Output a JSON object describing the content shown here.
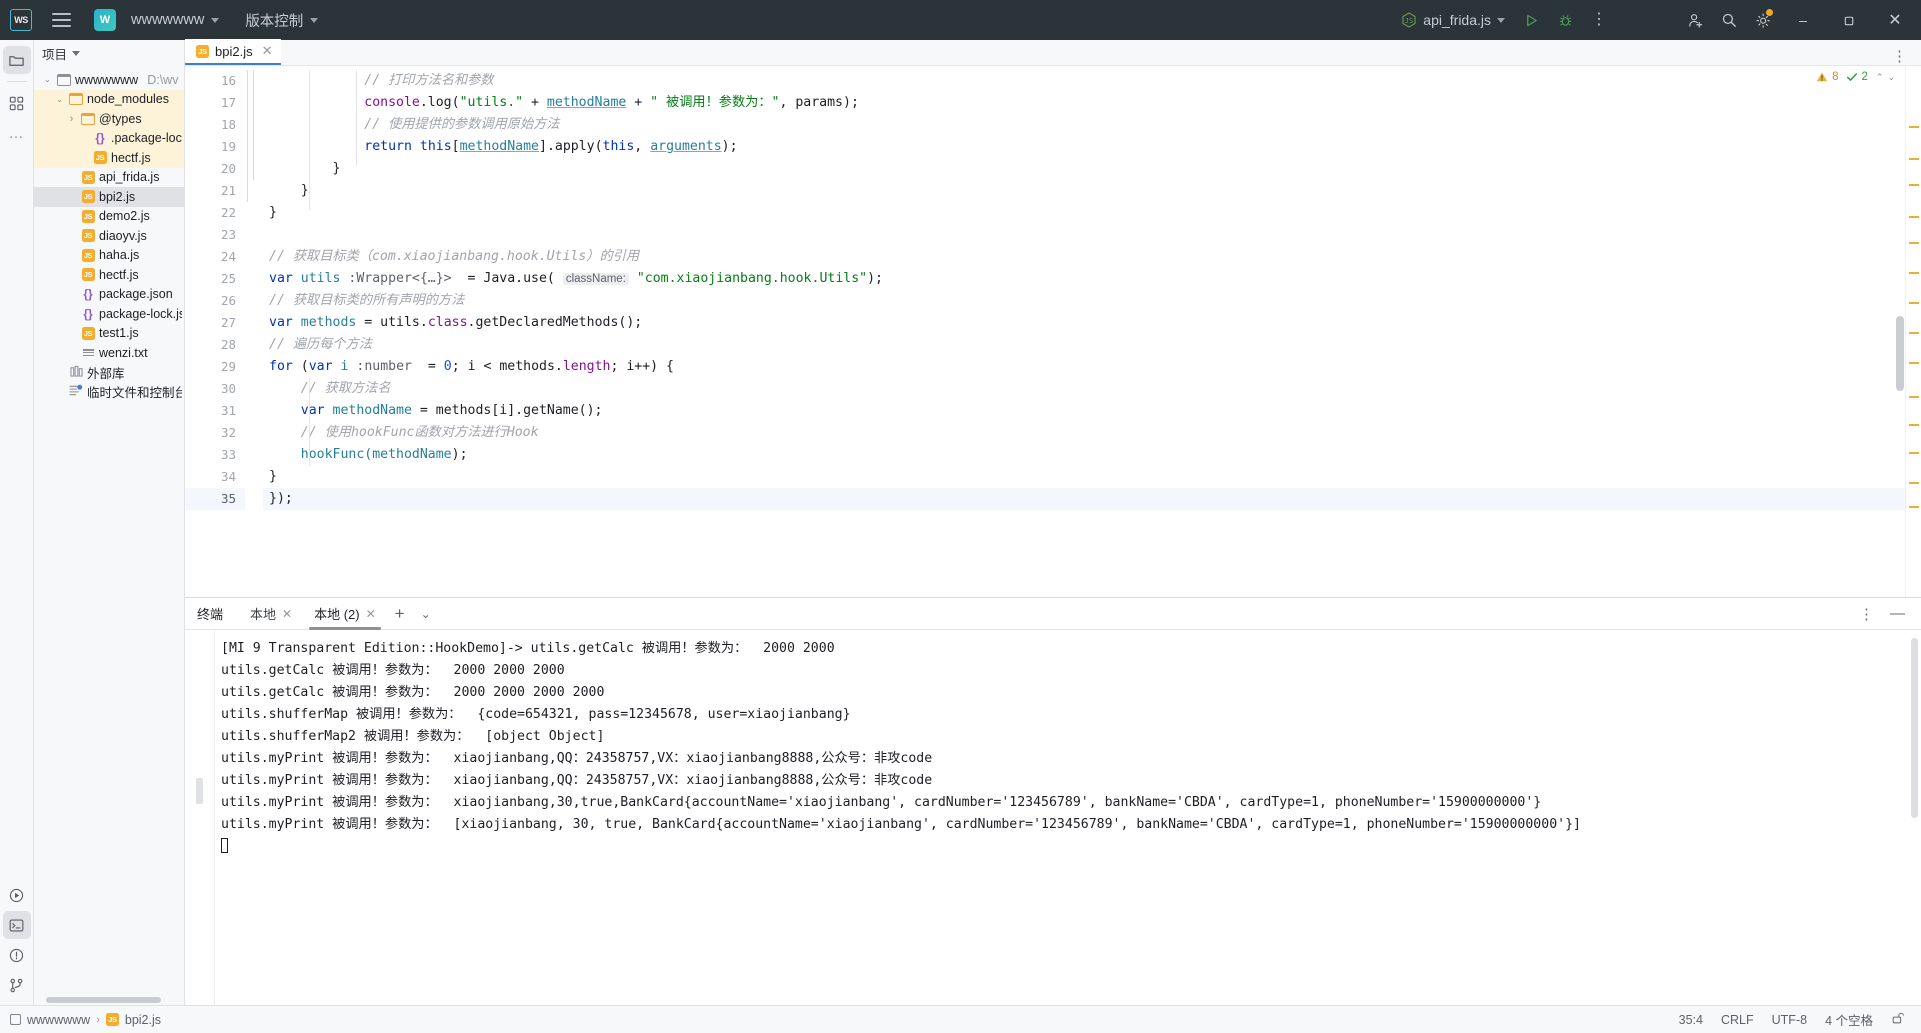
{
  "titlebar": {
    "logo_text": "WS",
    "menu_icon": "hamburger-icon",
    "project_initial": "W",
    "project_name": "wwwwwww",
    "vcs_label": "版本控制",
    "run_config": "api_frida.js",
    "run_icon": "run-icon",
    "debug_icon": "debug-icon",
    "more_icon": "more-vertical-icon",
    "account_icon": "add-account-icon",
    "search_icon": "search-icon",
    "settings_icon": "gear-icon",
    "minimize": "–",
    "maximize": "❐",
    "close": "✕"
  },
  "toolstrip": {
    "top": [
      {
        "name": "project-tool-icon",
        "glyph": "folder"
      },
      {
        "name": "structure-tool-icon",
        "glyph": "blocks"
      },
      {
        "name": "more-tools-icon",
        "glyph": "dots"
      }
    ],
    "bottom": [
      {
        "name": "run-tool-icon",
        "glyph": "play"
      },
      {
        "name": "terminal-tool-icon",
        "glyph": "terminal"
      },
      {
        "name": "problems-tool-icon",
        "glyph": "warn"
      },
      {
        "name": "vcs-tool-icon",
        "glyph": "branch"
      },
      {
        "name": "notifications-icon",
        "glyph": "bell"
      }
    ]
  },
  "project_panel": {
    "header": "项目",
    "tree": [
      {
        "depth": 0,
        "arrow": "down",
        "icon": "folder",
        "label": "wwwwwww",
        "suffix": "D:\\wv",
        "state": "normal"
      },
      {
        "depth": 1,
        "arrow": "down",
        "icon": "folder-orange",
        "label": "node_modules",
        "suffix": "",
        "state": "highlight"
      },
      {
        "depth": 2,
        "arrow": "right",
        "icon": "folder-orange",
        "label": "@types",
        "suffix": "",
        "state": "highlight"
      },
      {
        "depth": 3,
        "arrow": "none",
        "icon": "json",
        "label": ".package-loc",
        "suffix": "",
        "state": "highlight"
      },
      {
        "depth": 3,
        "arrow": "none",
        "icon": "js",
        "label": "hectf.js",
        "suffix": "",
        "state": "highlight"
      },
      {
        "depth": 2,
        "arrow": "none",
        "icon": "js",
        "label": "api_frida.js",
        "suffix": "",
        "state": "normal"
      },
      {
        "depth": 2,
        "arrow": "none",
        "icon": "js",
        "label": "bpi2.js",
        "suffix": "",
        "state": "selected"
      },
      {
        "depth": 2,
        "arrow": "none",
        "icon": "js",
        "label": "demo2.js",
        "suffix": "",
        "state": "normal"
      },
      {
        "depth": 2,
        "arrow": "none",
        "icon": "js",
        "label": "diaoyv.js",
        "suffix": "",
        "state": "normal"
      },
      {
        "depth": 2,
        "arrow": "none",
        "icon": "js",
        "label": "haha.js",
        "suffix": "",
        "state": "normal"
      },
      {
        "depth": 2,
        "arrow": "none",
        "icon": "js",
        "label": "hectf.js",
        "suffix": "",
        "state": "normal"
      },
      {
        "depth": 2,
        "arrow": "none",
        "icon": "json",
        "label": "package.json",
        "suffix": "",
        "state": "normal"
      },
      {
        "depth": 2,
        "arrow": "none",
        "icon": "json",
        "label": "package-lock.jso",
        "suffix": "",
        "state": "normal"
      },
      {
        "depth": 2,
        "arrow": "none",
        "icon": "js",
        "label": "test1.js",
        "suffix": "",
        "state": "normal"
      },
      {
        "depth": 2,
        "arrow": "none",
        "icon": "txt",
        "label": "wenzi.txt",
        "suffix": "",
        "state": "normal"
      },
      {
        "depth": 1,
        "arrow": "none",
        "icon": "lib",
        "label": "外部库",
        "suffix": "",
        "state": "normal"
      },
      {
        "depth": 1,
        "arrow": "none",
        "icon": "scratch",
        "label": "临时文件和控制台",
        "suffix": "",
        "state": "normal"
      }
    ]
  },
  "editor": {
    "tab": {
      "label": "bpi2.js",
      "close": "✕",
      "icon": "js-file-icon"
    },
    "kebab": "⋮",
    "inspection": {
      "warn_count": "8",
      "ok_count": "2",
      "warn_icon": "warning-triangle-icon",
      "ok_icon": "check-icon",
      "up": "⌃",
      "down": "⌄"
    },
    "first_line_number": 16,
    "lines": [
      {
        "n": 16,
        "segments": [
          {
            "t": "            // 打印方法名和参数",
            "c": "c-cmt"
          }
        ]
      },
      {
        "n": 17,
        "segments": [
          {
            "t": "            console",
            "c": "c-prop"
          },
          {
            "t": ".log(",
            "c": "c-type"
          },
          {
            "t": "\"utils.\"",
            "c": "c-str"
          },
          {
            "t": " + ",
            "c": "c-type"
          },
          {
            "t": "methodName",
            "c": "c-local c-und"
          },
          {
            "t": " + ",
            "c": "c-type"
          },
          {
            "t": "\" 被调用！参数为：\"",
            "c": "c-str"
          },
          {
            "t": ", params);",
            "c": "c-type"
          }
        ]
      },
      {
        "n": 18,
        "segments": [
          {
            "t": "            // 使用提供的参数调用原始方法",
            "c": "c-cmt"
          }
        ]
      },
      {
        "n": 19,
        "segments": [
          {
            "t": "            ",
            "c": "c-type"
          },
          {
            "t": "return",
            "c": "c-kw"
          },
          {
            "t": " ",
            "c": "c-type"
          },
          {
            "t": "this",
            "c": "c-kw"
          },
          {
            "t": "[",
            "c": "c-type"
          },
          {
            "t": "methodName",
            "c": "c-local c-und"
          },
          {
            "t": "].apply(",
            "c": "c-type"
          },
          {
            "t": "this",
            "c": "c-kw"
          },
          {
            "t": ", ",
            "c": "c-type"
          },
          {
            "t": "arguments",
            "c": "c-local c-und"
          },
          {
            "t": ");",
            "c": "c-type"
          }
        ]
      },
      {
        "n": 20,
        "segments": [
          {
            "t": "        }",
            "c": "c-type"
          }
        ]
      },
      {
        "n": 21,
        "segments": [
          {
            "t": "    }",
            "c": "c-type"
          }
        ]
      },
      {
        "n": 22,
        "segments": [
          {
            "t": "}",
            "c": "c-type"
          }
        ]
      },
      {
        "n": 23,
        "segments": [
          {
            "t": "",
            "c": "c-type"
          }
        ]
      },
      {
        "n": 24,
        "segments": [
          {
            "t": "// 获取目标类（com.xiaojianbang.hook.Utils）的引用",
            "c": "c-cmt"
          }
        ]
      },
      {
        "n": 25,
        "segments": [
          {
            "t": "var",
            "c": "c-kw"
          },
          {
            "t": " utils",
            "c": "c-local"
          },
          {
            "t": " :Wrapper<{…}>",
            "c": "c-typehint"
          },
          {
            "t": "  = Java.",
            "c": "c-type"
          },
          {
            "t": "use",
            "c": "c-type"
          },
          {
            "t": "( ",
            "c": "c-type"
          },
          {
            "t": "className:",
            "c": "c-hint"
          },
          {
            "t": " \"com.xiaojianbang.hook.Utils\"",
            "c": "c-str"
          },
          {
            "t": ");",
            "c": "c-type"
          }
        ]
      },
      {
        "n": 26,
        "segments": [
          {
            "t": "// 获取目标类的所有声明的方法",
            "c": "c-cmt"
          }
        ]
      },
      {
        "n": 27,
        "segments": [
          {
            "t": "var",
            "c": "c-kw"
          },
          {
            "t": " methods",
            "c": "c-local"
          },
          {
            "t": " = utils.",
            "c": "c-type"
          },
          {
            "t": "class",
            "c": "c-prop"
          },
          {
            "t": ".getDeclaredMethods();",
            "c": "c-type"
          }
        ]
      },
      {
        "n": 28,
        "segments": [
          {
            "t": "// 遍历每个方法",
            "c": "c-cmt"
          }
        ]
      },
      {
        "n": 29,
        "segments": [
          {
            "t": "for",
            "c": "c-kw"
          },
          {
            "t": " (",
            "c": "c-type"
          },
          {
            "t": "var",
            "c": "c-kw"
          },
          {
            "t": " i",
            "c": "c-local"
          },
          {
            "t": " :number",
            "c": "c-typehint"
          },
          {
            "t": "  = ",
            "c": "c-type"
          },
          {
            "t": "0",
            "c": "c-num"
          },
          {
            "t": "; i < methods.",
            "c": "c-type"
          },
          {
            "t": "length",
            "c": "c-prop"
          },
          {
            "t": "; i++) {",
            "c": "c-type"
          }
        ]
      },
      {
        "n": 30,
        "segments": [
          {
            "t": "    // 获取方法名",
            "c": "c-cmt"
          }
        ]
      },
      {
        "n": 31,
        "segments": [
          {
            "t": "    ",
            "c": "c-type"
          },
          {
            "t": "var",
            "c": "c-kw"
          },
          {
            "t": " methodName",
            "c": "c-local"
          },
          {
            "t": " = methods[i].getName();",
            "c": "c-type"
          }
        ]
      },
      {
        "n": 32,
        "segments": [
          {
            "t": "    // 使用hookFunc函数对方法进行Hook",
            "c": "c-cmt"
          }
        ]
      },
      {
        "n": 33,
        "segments": [
          {
            "t": "    hookFunc(",
            "c": "c-local"
          },
          {
            "t": "methodName",
            "c": "c-local"
          },
          {
            "t": ");",
            "c": "c-type"
          }
        ]
      },
      {
        "n": 34,
        "segments": [
          {
            "t": "}",
            "c": "c-type"
          }
        ]
      },
      {
        "n": 35,
        "segments": [
          {
            "t": "});",
            "c": "c-type"
          }
        ],
        "current": true
      }
    ]
  },
  "terminal": {
    "title": "终端",
    "tabs": [
      {
        "label": "本地",
        "active": false,
        "close": "✕"
      },
      {
        "label": "本地 (2)",
        "active": true,
        "close": "✕"
      }
    ],
    "add_label": "+",
    "dropdown": "⌄",
    "options_icon": "more-vertical-icon",
    "minimize_icon": "minimize-icon",
    "output": [
      "[MI 9 Transparent Edition::HookDemo]-> utils.getCalc 被调用！参数为：  2000 2000",
      "utils.getCalc 被调用！参数为：  2000 2000 2000",
      "utils.getCalc 被调用！参数为：  2000 2000 2000 2000",
      "utils.shufferMap 被调用！参数为：  {code=654321, pass=12345678, user=xiaojianbang}",
      "utils.shufferMap2 被调用！参数为：  [object Object]",
      "utils.myPrint 被调用！参数为：  xiaojianbang,QQ：24358757,VX：xiaojianbang8888,公众号：非攻code",
      "utils.myPrint 被调用！参数为：  xiaojianbang,QQ：24358757,VX：xiaojianbang8888,公众号：非攻code",
      "utils.myPrint 被调用！参数为：  xiaojianbang,30,true,BankCard{accountName='xiaojianbang', cardNumber='123456789', bankName='CBDA', cardType=1, phoneNumber='15900000000'}",
      "utils.myPrint 被调用！参数为：  [xiaojianbang, 30, true, BankCard{accountName='xiaojianbang', cardNumber='123456789', bankName='CBDA', cardType=1, phoneNumber='15900000000'}]"
    ]
  },
  "statusbar": {
    "breadcrumb_project": "wwwwwww",
    "breadcrumb_sep": "›",
    "breadcrumb_file": "bpi2.js",
    "caret": "35:4",
    "line_sep": "CRLF",
    "encoding": "UTF-8",
    "indent": "4 个空格",
    "lock_icon": "unlocked-icon"
  },
  "colors": {
    "titlebar_bg": "#2b3438",
    "panel_bg": "#f7f8fa",
    "editor_bg": "#ffffff",
    "accent_blue": "#3b7ddd",
    "js_yellow": "#f4ad2e",
    "highlight_yellow": "#fdf3d8",
    "selection_gray": "#dfe1e5"
  }
}
